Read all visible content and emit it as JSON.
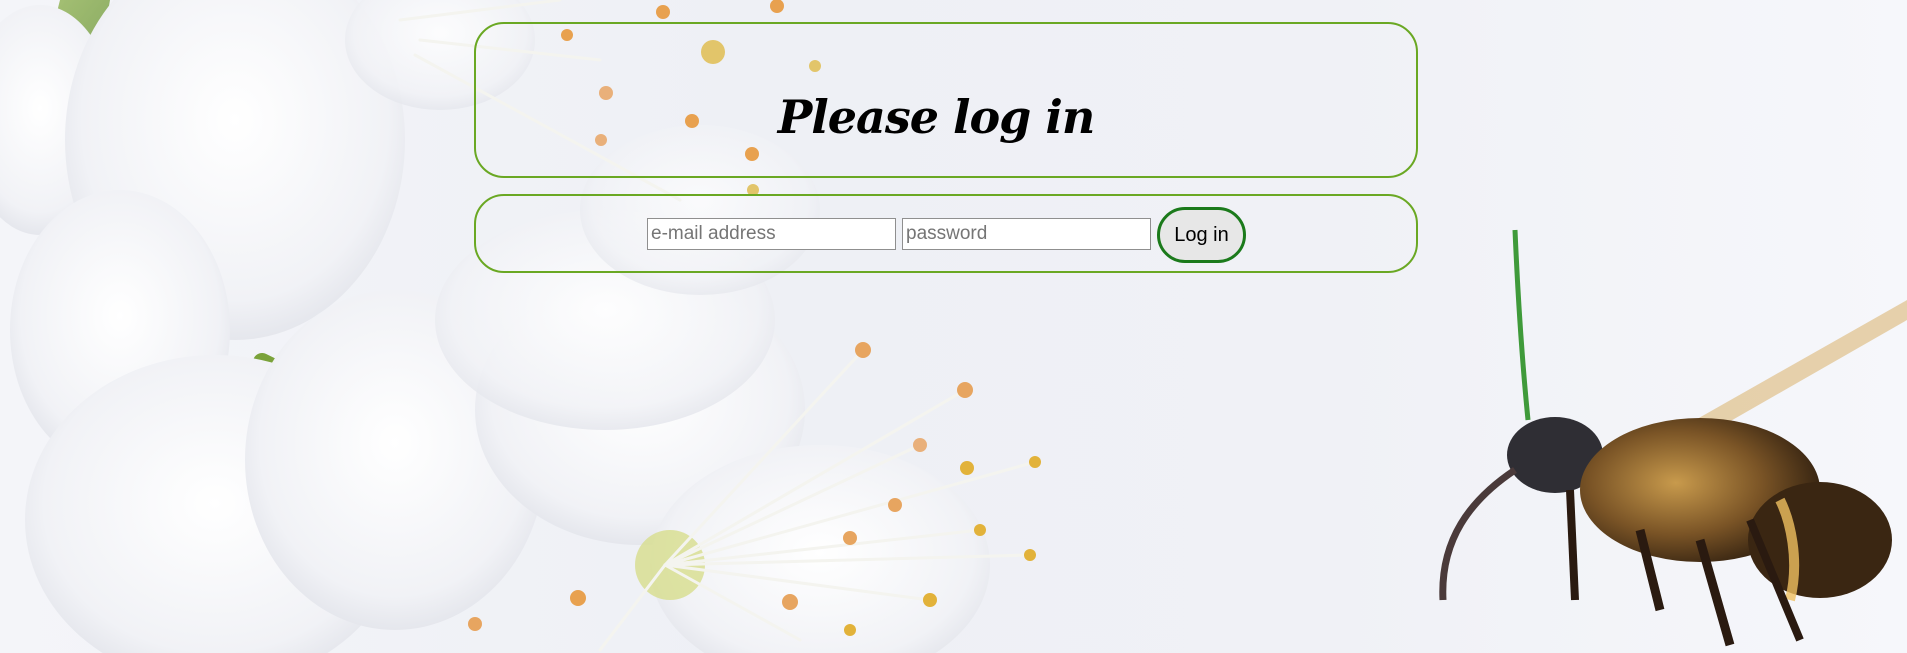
{
  "page": {
    "heading": "Please log in"
  },
  "login_form": {
    "email_placeholder": "e-mail address",
    "password_placeholder": "password",
    "submit_label": "Log in"
  },
  "colors": {
    "panel_border": "#6aa823",
    "button_border": "#1b7a1b",
    "button_fill": "#e7e7e7"
  }
}
